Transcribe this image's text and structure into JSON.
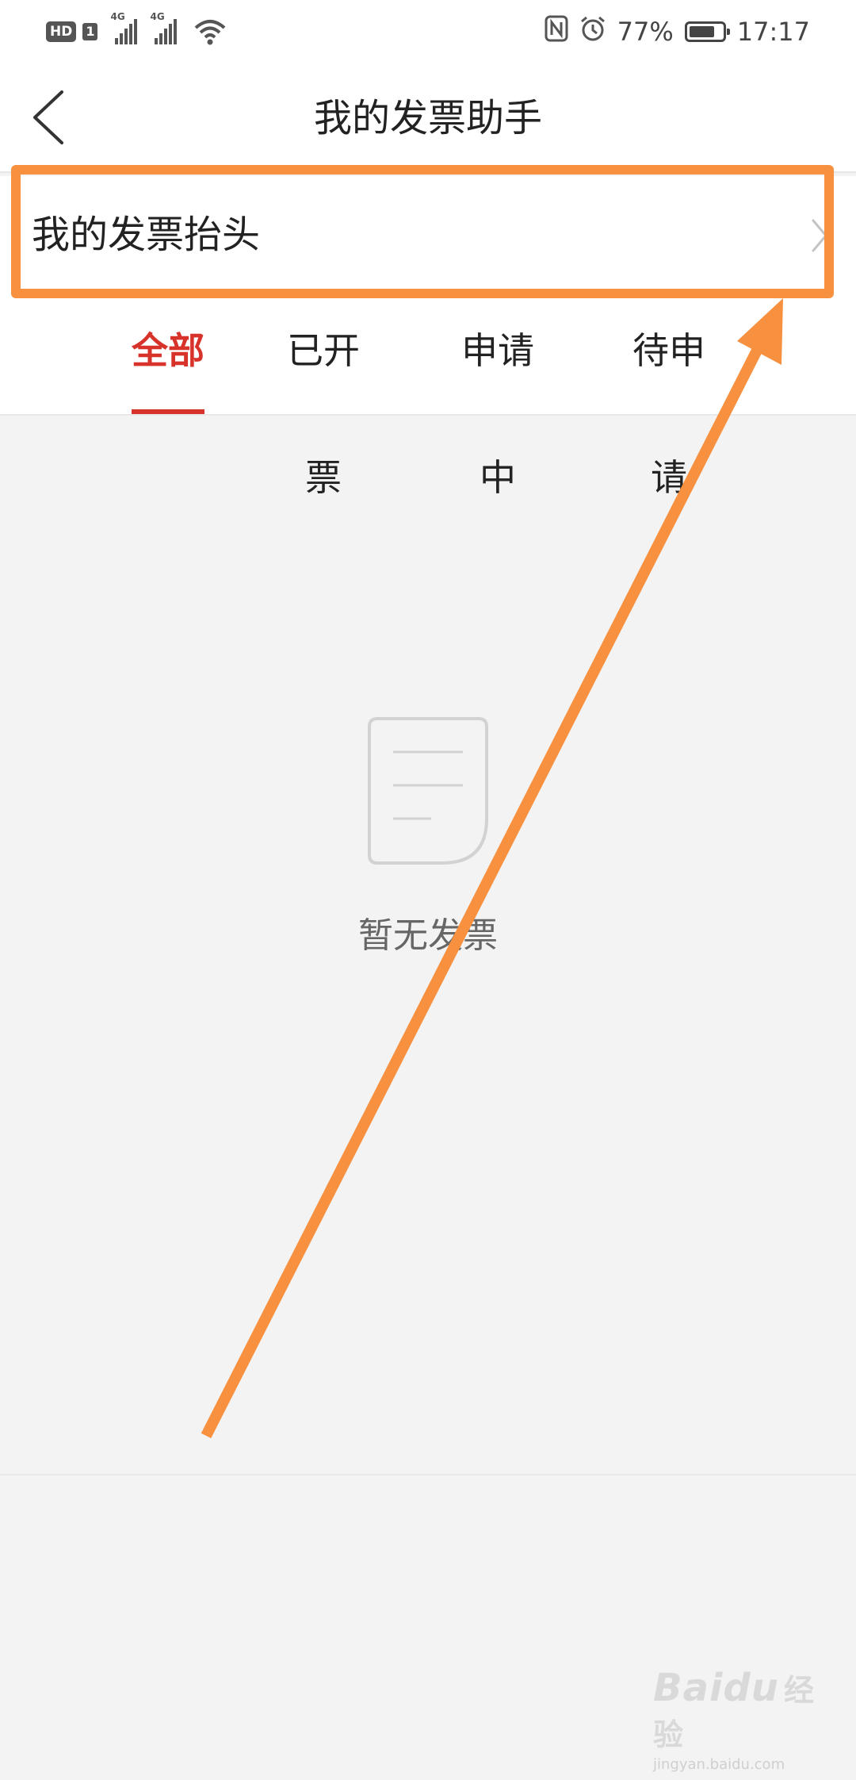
{
  "status_bar": {
    "hd_label": "HD",
    "sim_label": "1",
    "network_1": "4G",
    "network_2": "4G",
    "battery_percent": "77%",
    "battery_level": 0.77,
    "time": "17:17"
  },
  "header": {
    "title": "我的发票助手",
    "back_icon": "chevron-left-icon"
  },
  "invoice_header_row": {
    "label": "我的发票抬头",
    "chevron_icon": "chevron-right-icon"
  },
  "tabs": [
    {
      "label": "全部",
      "active": true
    },
    {
      "label": "已开票",
      "active": false
    },
    {
      "label": "申请中",
      "active": false
    },
    {
      "label": "待申请",
      "active": false
    }
  ],
  "empty_state": {
    "icon": "document-icon",
    "text": "暂无发票"
  },
  "watermark": {
    "logo": "Baidu",
    "logo_cn": "经验",
    "url": "jingyan.baidu.com"
  },
  "colors": {
    "accent_red": "#d8332b",
    "annotation_orange": "#f7903f",
    "background": "#f3f3f3"
  }
}
